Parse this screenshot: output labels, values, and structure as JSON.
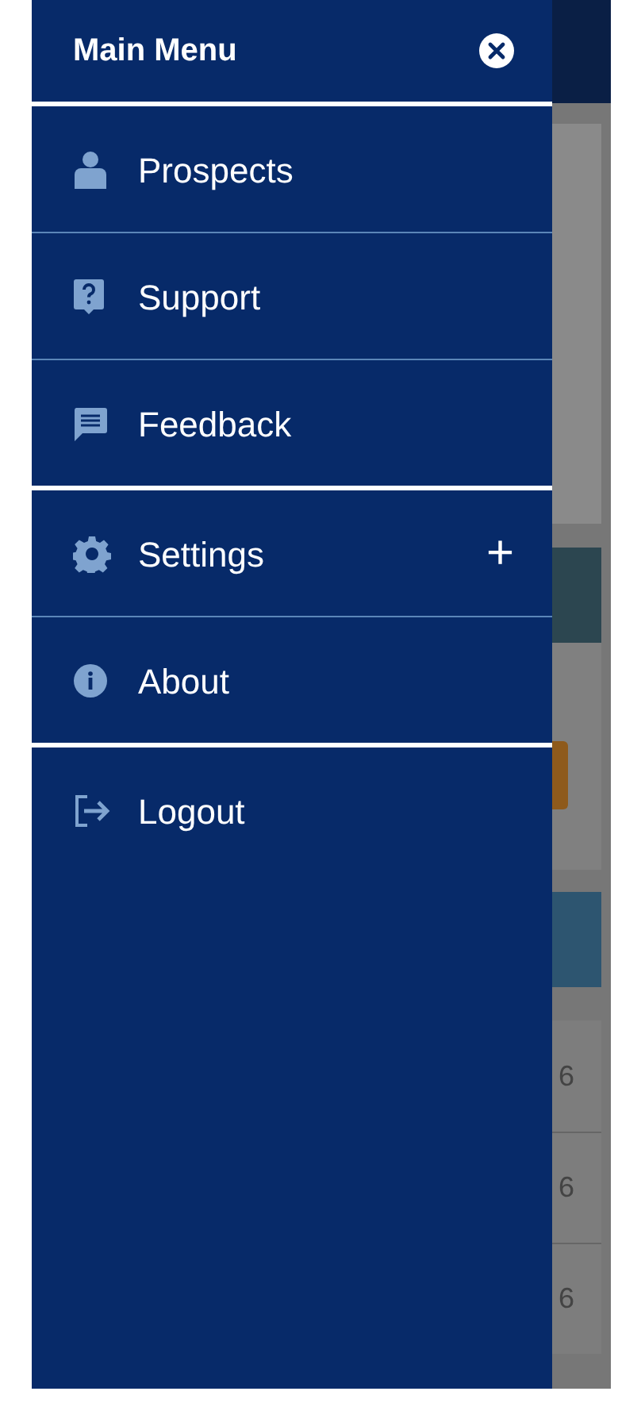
{
  "menu": {
    "title": "Main Menu",
    "items": [
      {
        "label": "Prospects",
        "group_end": false
      },
      {
        "label": "Support",
        "group_end": false
      },
      {
        "label": "Feedback",
        "group_end": true
      },
      {
        "label": "Settings",
        "group_end": false,
        "expand_symbol": "+"
      },
      {
        "label": "About",
        "group_end": true
      },
      {
        "label": "Logout"
      }
    ]
  },
  "background": {
    "prospect_dates": [
      "6",
      "6",
      "6"
    ]
  }
}
